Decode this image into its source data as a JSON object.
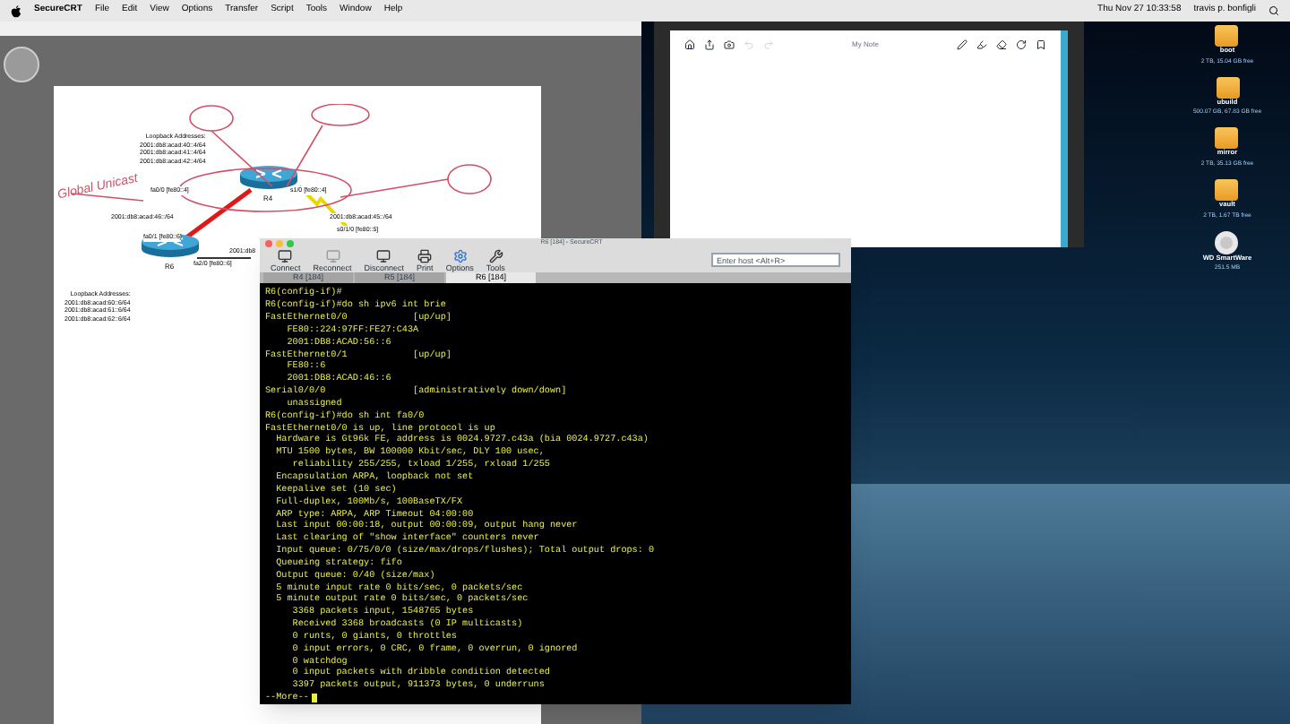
{
  "menu_bar": {
    "app_name": "SecureCRT",
    "items": [
      "File",
      "Edit",
      "View",
      "Options",
      "Transfer",
      "Script",
      "Tools",
      "Window",
      "Help"
    ],
    "clock": "Thu Nov 27  10:33:58",
    "user": "travis p. bonfigli"
  },
  "diagram": {
    "routers": [
      {
        "name": "R4"
      },
      {
        "name": "R6"
      }
    ],
    "address_blocks": [
      {
        "title": "Loopback Addresses:",
        "lines": [
          "2001:db8:acad:40::4/64",
          "2001:db8:acad:41::4/64",
          "2001:db8:acad:42::4/64"
        ]
      },
      {
        "title": "Loopback Addresses:",
        "lines": [
          "2001:db8:acad:60::6/64",
          "2001:db8:acad:61::6/64",
          "2001:db8:acad:62::6/64"
        ]
      }
    ],
    "labels": [
      "fa0/0 [fe80::4]",
      "s1/0 [fe80::4]",
      "2001:db8:acad:46::/64",
      "fa0/1 [fe80::6]",
      "2001:db8:acad:45::/64",
      "s0/1/0 [fe80::5]",
      "fa2/0 [fe80::6]",
      "2001:db8"
    ],
    "handwriting": "Global Unicast"
  },
  "notes_window": {
    "title": "My Note"
  },
  "terminal": {
    "title": "R6 [184] - SecureCRT",
    "toolbar": [
      "Connect",
      "Reconnect",
      "Disconnect",
      "Print",
      "Options",
      "Tools"
    ],
    "search_placeholder": "Enter host <Alt+R>",
    "tabs": [
      {
        "label": "R4 [184]",
        "selected": false
      },
      {
        "label": "R5 [184]",
        "selected": false
      },
      {
        "label": "R6 [184]",
        "selected": true
      }
    ],
    "lines": [
      "R6(config-if)#",
      "R6(config-if)#do sh ipv6 int brie",
      "FastEthernet0/0            [up/up]",
      "    FE80::224:97FF:FE27:C43A",
      "    2001:DB8:ACAD:56::6",
      "FastEthernet0/1            [up/up]",
      "    FE80::6",
      "    2001:DB8:ACAD:46::6",
      "Serial0/0/0                [administratively down/down]",
      "    unassigned",
      "R6(config-if)#do sh int fa0/0",
      "FastEthernet0/0 is up, line protocol is up",
      "  Hardware is Gt96k FE, address is 0024.9727.c43a (bia 0024.9727.c43a)",
      "  MTU 1500 bytes, BW 100000 Kbit/sec, DLY 100 usec,",
      "     reliability 255/255, txload 1/255, rxload 1/255",
      "  Encapsulation ARPA, loopback not set",
      "  Keepalive set (10 sec)",
      "  Full-duplex, 100Mb/s, 100BaseTX/FX",
      "  ARP type: ARPA, ARP Timeout 04:00:00",
      "  Last input 00:00:18, output 00:00:09, output hang never",
      "  Last clearing of \"show interface\" counters never",
      "  Input queue: 0/75/0/0 (size/max/drops/flushes); Total output drops: 0",
      "  Queueing strategy: fifo",
      "  Output queue: 0/40 (size/max)",
      "  5 minute input rate 0 bits/sec, 0 packets/sec",
      "  5 minute output rate 0 bits/sec, 0 packets/sec",
      "     3368 packets input, 1548765 bytes",
      "     Received 3368 broadcasts (0 IP multicasts)",
      "     0 runts, 0 giants, 0 throttles",
      "     0 input errors, 0 CRC, 0 frame, 0 overrun, 0 ignored",
      "     0 watchdog",
      "     0 input packets with dribble condition detected",
      "     3397 packets output, 911373 bytes, 0 underruns"
    ],
    "more_prompt": "--More--"
  },
  "desktop_icons": [
    {
      "kind": "drive",
      "name": "boot",
      "info": "2 TB, 15.04 GB free"
    },
    {
      "kind": "drive",
      "name": "ubuild",
      "info": "500.07 GB, 67.83 GB free"
    },
    {
      "kind": "drive",
      "name": "mirror",
      "info": "2 TB, 35.13 GB free"
    },
    {
      "kind": "drive",
      "name": "vault",
      "info": "2 TB, 1.67 TB free"
    },
    {
      "kind": "disc",
      "name": "WD SmartWare",
      "info": "251.5 MB"
    }
  ]
}
